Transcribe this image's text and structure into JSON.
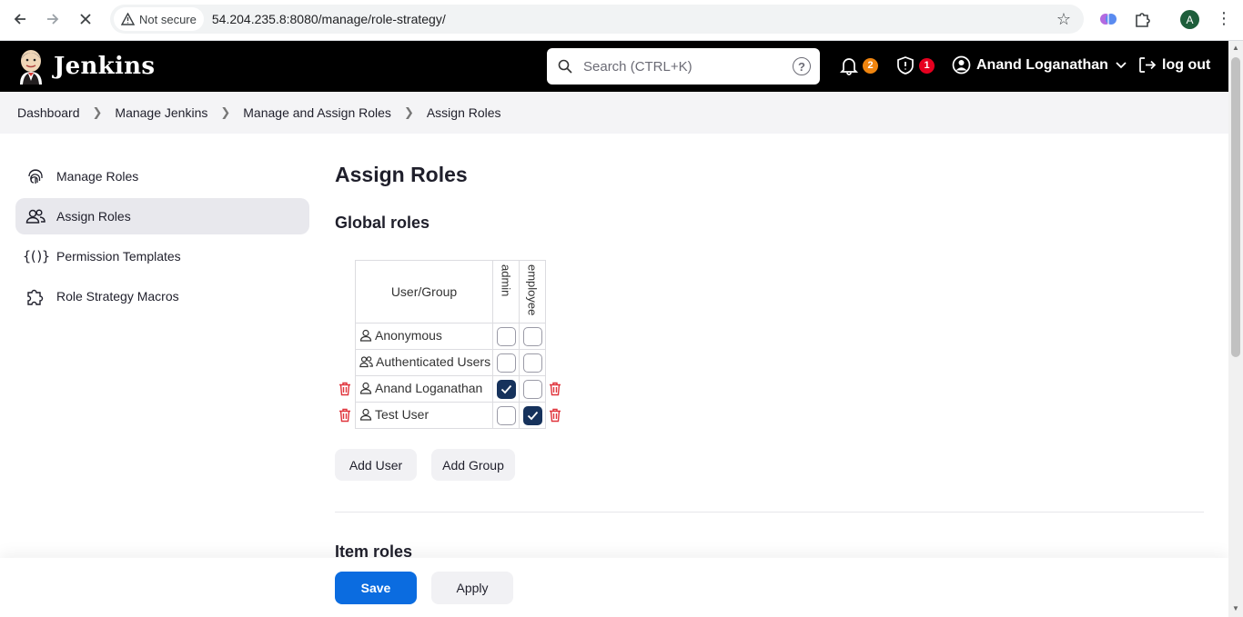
{
  "browser": {
    "back_icon": "arrow-left-icon",
    "forward_icon": "arrow-right-icon",
    "stop_icon": "close-icon",
    "security_label": "Not secure",
    "url": "54.204.235.8:8080/manage/role-strategy/",
    "profile_initial": "A"
  },
  "header": {
    "logo_text": "Jenkins",
    "search_placeholder": "Search (CTRL+K)",
    "notifications_count": "2",
    "security_count": "1",
    "user_name": "Anand Loganathan",
    "logout_label": "log out",
    "colors": {
      "notif_badge": "#f0850f",
      "security_badge": "#e6001f"
    }
  },
  "breadcrumb": [
    "Dashboard",
    "Manage Jenkins",
    "Manage and Assign Roles",
    "Assign Roles"
  ],
  "sidebar": {
    "items": [
      {
        "label": "Manage Roles",
        "icon": "fingerprint-icon",
        "active": false
      },
      {
        "label": "Assign Roles",
        "icon": "users-icon",
        "active": true
      },
      {
        "label": "Permission Templates",
        "icon": "braces-icon",
        "active": false
      },
      {
        "label": "Role Strategy Macros",
        "icon": "puzzle-icon",
        "active": false
      }
    ]
  },
  "main": {
    "title": "Assign Roles",
    "global_roles_title": "Global roles",
    "item_roles_title": "Item roles",
    "table": {
      "header": "User/Group",
      "roles": [
        "admin",
        "employee"
      ],
      "rows": [
        {
          "name": "Anonymous",
          "type": "user",
          "checks": [
            false,
            false
          ],
          "deletable": false
        },
        {
          "name": "Authenticated Users",
          "type": "group",
          "checks": [
            false,
            false
          ],
          "deletable": false
        },
        {
          "name": "Anand Loganathan",
          "type": "user",
          "checks": [
            true,
            false
          ],
          "deletable": true
        },
        {
          "name": "Test User",
          "type": "user",
          "checks": [
            false,
            true
          ],
          "deletable": true
        }
      ]
    },
    "add_user_label": "Add User",
    "add_group_label": "Add Group"
  },
  "footer": {
    "save_label": "Save",
    "apply_label": "Apply"
  }
}
